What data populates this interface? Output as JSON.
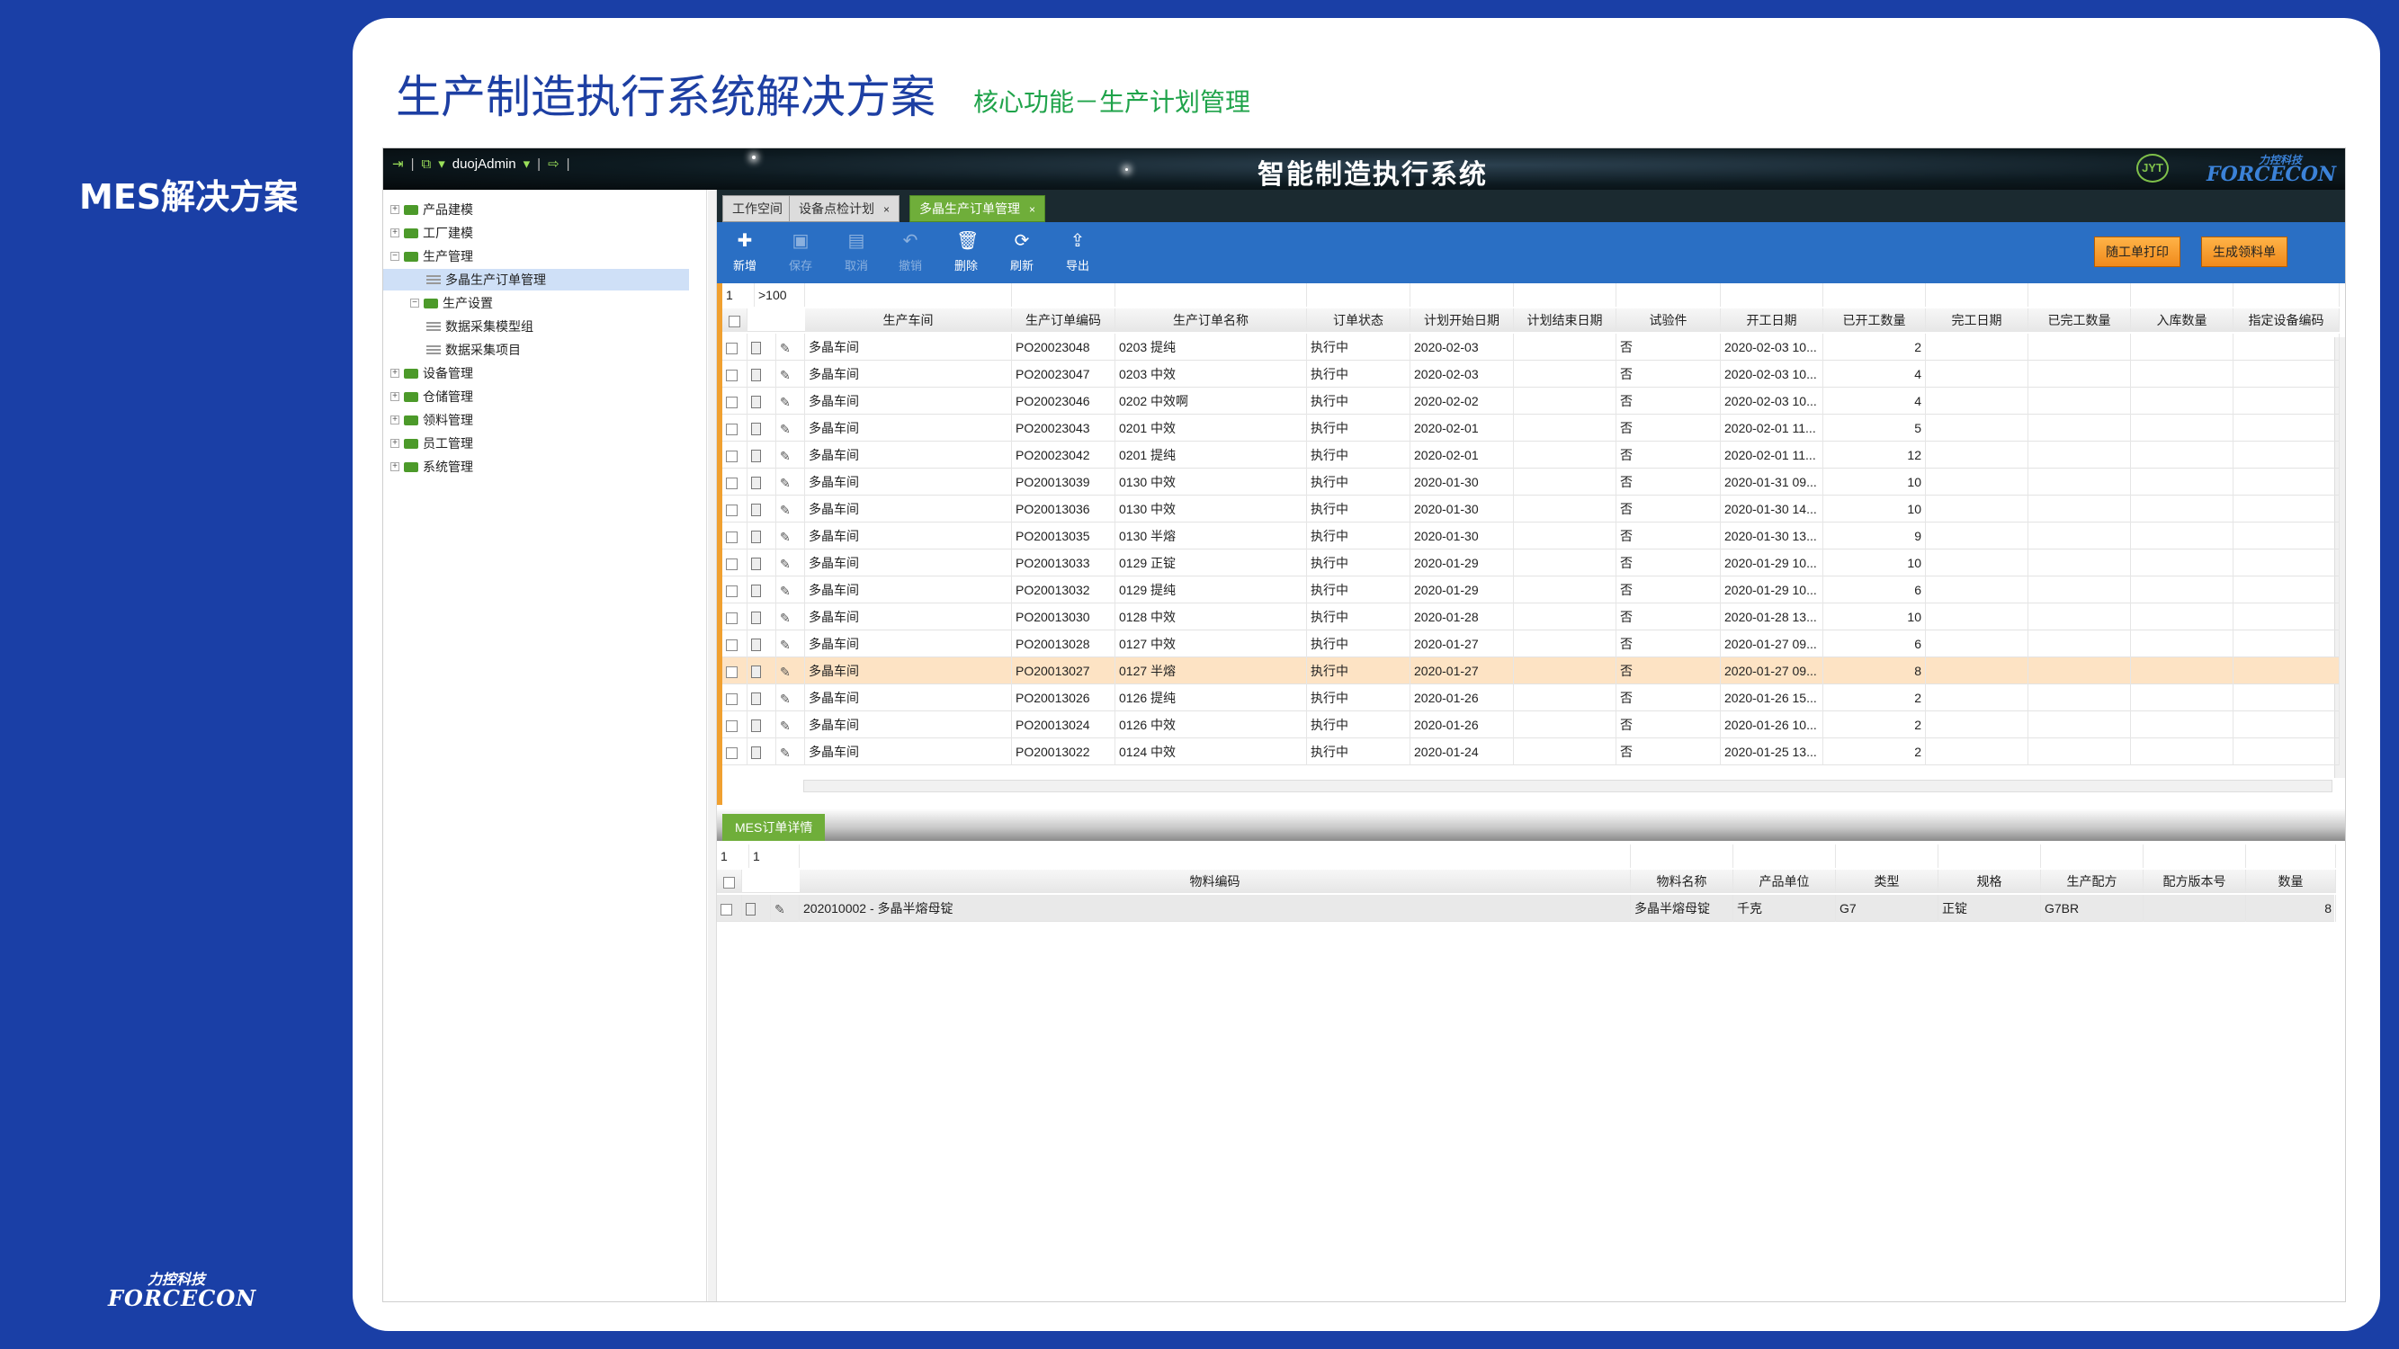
{
  "slide": {
    "left_label": "MES解决方案",
    "title": "生产制造执行系统解决方案",
    "subtitle": "核心功能－生产计划管理",
    "brand_cn": "力控科技",
    "brand_en": "FORCECON"
  },
  "app": {
    "title": "智能制造执行系统",
    "user": "duojAdmin",
    "logo_left": "JYT",
    "logo_right_cn": "力控科技",
    "logo_right_en": "FORCECON"
  },
  "tree": [
    {
      "label": "产品建模",
      "toggle": "+"
    },
    {
      "label": "工厂建模",
      "toggle": "+"
    },
    {
      "label": "生产管理",
      "toggle": "−"
    },
    {
      "label": "多晶生产订单管理",
      "toggle": ""
    },
    {
      "label": "生产设置",
      "toggle": "−"
    },
    {
      "label": "数据采集模型组",
      "toggle": ""
    },
    {
      "label": "数据采集项目",
      "toggle": ""
    },
    {
      "label": "设备管理",
      "toggle": "+"
    },
    {
      "label": "仓储管理",
      "toggle": "+"
    },
    {
      "label": "领料管理",
      "toggle": "+"
    },
    {
      "label": "员工管理",
      "toggle": "+"
    },
    {
      "label": "系统管理",
      "toggle": "+"
    }
  ],
  "tabs": [
    {
      "label": "工作空间",
      "close": ""
    },
    {
      "label": "设备点检计划",
      "close": "×"
    },
    {
      "label": "多晶生产订单管理",
      "close": "×"
    }
  ],
  "toolbar": {
    "buttons": [
      {
        "label": "新增",
        "icon": "add-doc-icon",
        "glyph": "✚"
      },
      {
        "label": "保存",
        "icon": "save-icon",
        "glyph": "▣"
      },
      {
        "label": "取消",
        "icon": "cancel-icon",
        "glyph": "▤"
      },
      {
        "label": "撤销",
        "icon": "undo-icon",
        "glyph": "↶"
      },
      {
        "label": "删除",
        "icon": "trash-icon",
        "glyph": "🗑"
      },
      {
        "label": "刷新",
        "icon": "refresh-icon",
        "glyph": "⟳"
      },
      {
        "label": "导出",
        "icon": "export-icon",
        "glyph": "⇪"
      }
    ],
    "print_label": "随工单打印",
    "generate_label": "生成领料单"
  },
  "grid": {
    "page": "1",
    "page_count": ">100",
    "headers": [
      "生产车间",
      "生产订单编码",
      "生产订单名称",
      "订单状态",
      "计划开始日期",
      "计划结束日期",
      "试验件",
      "开工日期",
      "已开工数量",
      "完工日期",
      "已完工数量",
      "入库数量",
      "指定设备编码"
    ],
    "rows": [
      [
        "多晶车间",
        "PO20023048",
        "0203 提纯",
        "执行中",
        "2020-02-03",
        "",
        "否",
        "2020-02-03 10...",
        "2",
        "",
        "",
        "",
        ""
      ],
      [
        "多晶车间",
        "PO20023047",
        "0203 中效",
        "执行中",
        "2020-02-03",
        "",
        "否",
        "2020-02-03 10...",
        "4",
        "",
        "",
        "",
        ""
      ],
      [
        "多晶车间",
        "PO20023046",
        "0202 中效啊",
        "执行中",
        "2020-02-02",
        "",
        "否",
        "2020-02-03 10...",
        "4",
        "",
        "",
        "",
        ""
      ],
      [
        "多晶车间",
        "PO20023043",
        "0201 中效",
        "执行中",
        "2020-02-01",
        "",
        "否",
        "2020-02-01 11...",
        "5",
        "",
        "",
        "",
        ""
      ],
      [
        "多晶车间",
        "PO20023042",
        "0201 提纯",
        "执行中",
        "2020-02-01",
        "",
        "否",
        "2020-02-01 11...",
        "12",
        "",
        "",
        "",
        ""
      ],
      [
        "多晶车间",
        "PO20013039",
        "0130 中效",
        "执行中",
        "2020-01-30",
        "",
        "否",
        "2020-01-31 09...",
        "10",
        "",
        "",
        "",
        ""
      ],
      [
        "多晶车间",
        "PO20013036",
        "0130 中效",
        "执行中",
        "2020-01-30",
        "",
        "否",
        "2020-01-30 14...",
        "10",
        "",
        "",
        "",
        ""
      ],
      [
        "多晶车间",
        "PO20013035",
        "0130 半熔",
        "执行中",
        "2020-01-30",
        "",
        "否",
        "2020-01-30 13...",
        "9",
        "",
        "",
        "",
        ""
      ],
      [
        "多晶车间",
        "PO20013033",
        "0129 正锭",
        "执行中",
        "2020-01-29",
        "",
        "否",
        "2020-01-29 10...",
        "10",
        "",
        "",
        "",
        ""
      ],
      [
        "多晶车间",
        "PO20013032",
        "0129 提纯",
        "执行中",
        "2020-01-29",
        "",
        "否",
        "2020-01-29 10...",
        "6",
        "",
        "",
        "",
        ""
      ],
      [
        "多晶车间",
        "PO20013030",
        "0128 中效",
        "执行中",
        "2020-01-28",
        "",
        "否",
        "2020-01-28 13...",
        "10",
        "",
        "",
        "",
        ""
      ],
      [
        "多晶车间",
        "PO20013028",
        "0127 中效",
        "执行中",
        "2020-01-27",
        "",
        "否",
        "2020-01-27 09...",
        "6",
        "",
        "",
        "",
        ""
      ],
      [
        "多晶车间",
        "PO20013027",
        "0127 半熔",
        "执行中",
        "2020-01-27",
        "",
        "否",
        "2020-01-27 09...",
        "8",
        "",
        "",
        "",
        ""
      ],
      [
        "多晶车间",
        "PO20013026",
        "0126 提纯",
        "执行中",
        "2020-01-26",
        "",
        "否",
        "2020-01-26 15...",
        "2",
        "",
        "",
        "",
        ""
      ],
      [
        "多晶车间",
        "PO20013024",
        "0126 中效",
        "执行中",
        "2020-01-26",
        "",
        "否",
        "2020-01-26 10...",
        "2",
        "",
        "",
        "",
        ""
      ],
      [
        "多晶车间",
        "PO20013022",
        "0124 中效",
        "执行中",
        "2020-01-24",
        "",
        "否",
        "2020-01-25 13...",
        "2",
        "",
        "",
        "",
        ""
      ]
    ],
    "highlight_row": 12
  },
  "detail": {
    "tab_label": "MES订单详情",
    "page": "1",
    "page_count": "1",
    "headers": [
      "物料编码",
      "物料名称",
      "产品单位",
      "类型",
      "规格",
      "生产配方",
      "配方版本号",
      "数量"
    ],
    "rows": [
      [
        "202010002 - 多晶半熔母锭",
        "多晶半熔母锭",
        "千克",
        "G7",
        "正锭",
        "G7BR",
        "",
        "8"
      ]
    ]
  },
  "colors": {
    "slide_bg": "#1a3fa6",
    "title_blue": "#1d3fa3",
    "subtitle_green": "#1fa34a",
    "toolbar_blue": "#2a6fc4",
    "tab_green": "#6fae3a",
    "orange_button": "#f08a1c",
    "row_highlight": "#fde3c4"
  }
}
